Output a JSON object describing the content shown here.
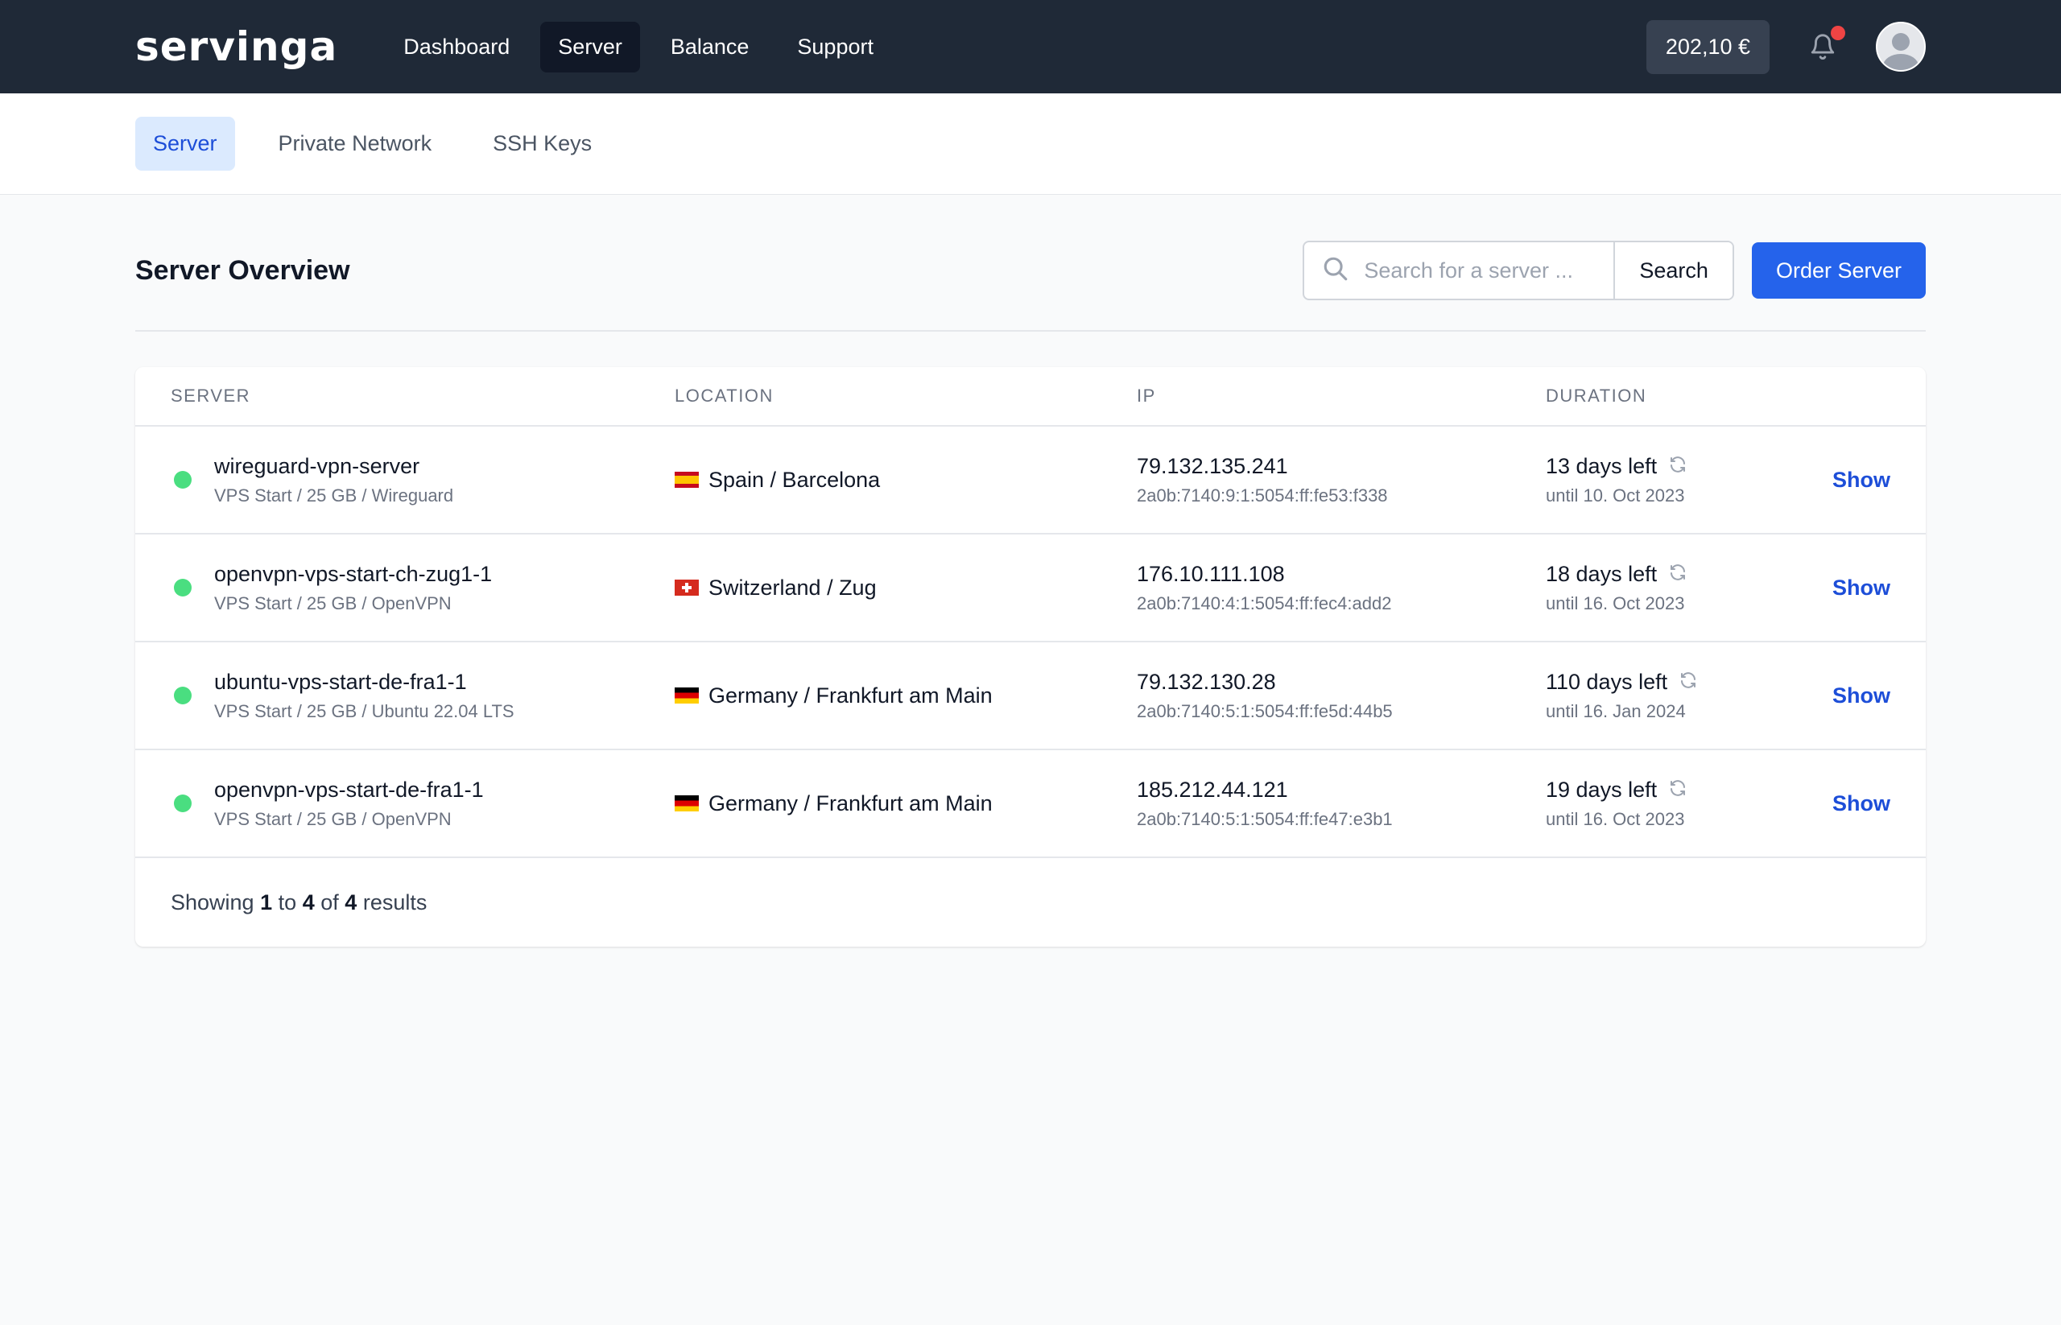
{
  "header": {
    "logo": "servinga",
    "nav": [
      {
        "label": "Dashboard",
        "active": false
      },
      {
        "label": "Server",
        "active": true
      },
      {
        "label": "Balance",
        "active": false
      },
      {
        "label": "Support",
        "active": false
      }
    ],
    "balance": "202,10 €",
    "icons": {
      "notifications": "bell-icon",
      "user": "avatar"
    }
  },
  "subnav": {
    "tabs": [
      {
        "label": "Server",
        "active": true
      },
      {
        "label": "Private Network",
        "active": false
      },
      {
        "label": "SSH Keys",
        "active": false
      }
    ]
  },
  "overview": {
    "title": "Server Overview",
    "search_placeholder": "Search for a server ...",
    "search_button": "Search",
    "order_button": "Order Server"
  },
  "table": {
    "columns": [
      "SERVER",
      "LOCATION",
      "IP",
      "DURATION"
    ],
    "rows": [
      {
        "name": "wireguard-vpn-server",
        "plan": "VPS Start / 25 GB / Wireguard",
        "flag": "es",
        "location": "Spain / Barcelona",
        "ipv4": "79.132.135.241",
        "ipv6": "2a0b:7140:9:1:5054:ff:fe53:f338",
        "duration": "13 days left",
        "until": "until 10. Oct 2023",
        "action": "Show"
      },
      {
        "name": "openvpn-vps-start-ch-zug1-1",
        "plan": "VPS Start / 25 GB / OpenVPN",
        "flag": "ch",
        "location": "Switzerland / Zug",
        "ipv4": "176.10.111.108",
        "ipv6": "2a0b:7140:4:1:5054:ff:fec4:add2",
        "duration": "18 days left",
        "until": "until 16. Oct 2023",
        "action": "Show"
      },
      {
        "name": "ubuntu-vps-start-de-fra1-1",
        "plan": "VPS Start / 25 GB / Ubuntu 22.04 LTS",
        "flag": "de",
        "location": "Germany / Frankfurt am Main",
        "ipv4": "79.132.130.28",
        "ipv6": "2a0b:7140:5:1:5054:ff:fe5d:44b5",
        "duration": "110 days left",
        "until": "until 16. Jan 2024",
        "action": "Show"
      },
      {
        "name": "openvpn-vps-start-de-fra1-1",
        "plan": "VPS Start / 25 GB / OpenVPN",
        "flag": "de",
        "location": "Germany / Frankfurt am Main",
        "ipv4": "185.212.44.121",
        "ipv6": "2a0b:7140:5:1:5054:ff:fe47:e3b1",
        "duration": "19 days left",
        "until": "until 16. Oct 2023",
        "action": "Show"
      }
    ],
    "footer": {
      "prefix": "Showing",
      "from": "1",
      "to_word": "to",
      "to": "4",
      "of_word": "of",
      "total": "4",
      "suffix": "results"
    }
  },
  "colors": {
    "topbar": "#1f2937",
    "accent": "#2563eb",
    "status_online": "#4ade80",
    "notification": "#ef4444"
  }
}
